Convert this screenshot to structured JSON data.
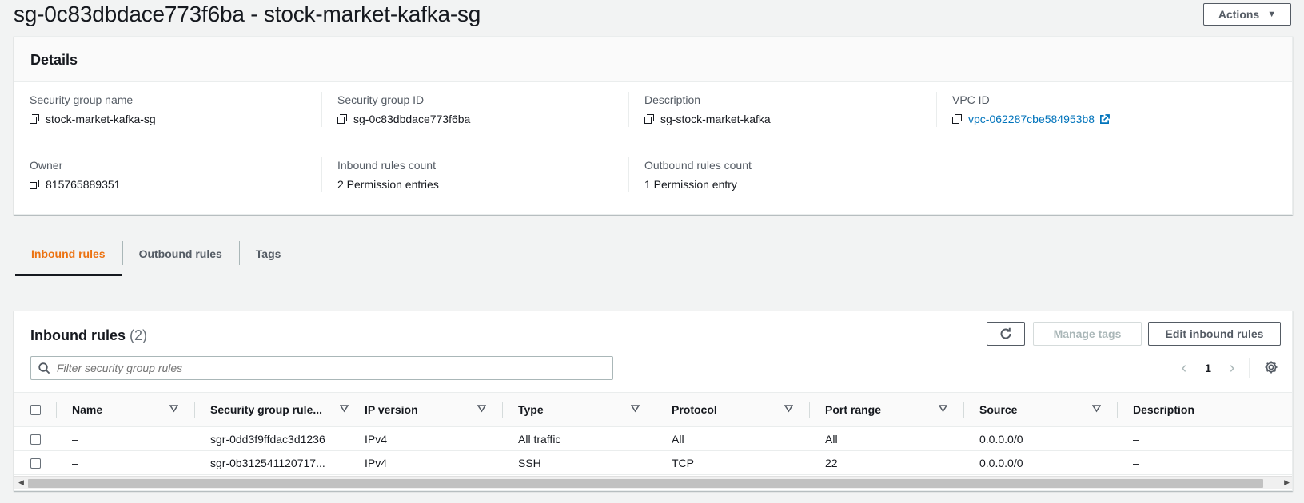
{
  "header": {
    "title": "sg-0c83dbdace773f6ba - stock-market-kafka-sg",
    "actions_label": "Actions"
  },
  "details": {
    "title": "Details",
    "fields": {
      "sg_name": {
        "label": "Security group name",
        "value": "stock-market-kafka-sg"
      },
      "sg_id": {
        "label": "Security group ID",
        "value": "sg-0c83dbdace773f6ba"
      },
      "description": {
        "label": "Description",
        "value": "sg-stock-market-kafka"
      },
      "vpc_id": {
        "label": "VPC ID",
        "value": "vpc-062287cbe584953b8"
      },
      "owner": {
        "label": "Owner",
        "value": "815765889351"
      },
      "inbound_count": {
        "label": "Inbound rules count",
        "value": "2 Permission entries"
      },
      "outbound_count": {
        "label": "Outbound rules count",
        "value": "1 Permission entry"
      }
    }
  },
  "tabs": [
    {
      "label": "Inbound rules",
      "active": true
    },
    {
      "label": "Outbound rules",
      "active": false
    },
    {
      "label": "Tags",
      "active": false
    }
  ],
  "rules": {
    "title": "Inbound rules",
    "count": "(2)",
    "manage_tags_label": "Manage tags",
    "edit_label": "Edit inbound rules",
    "filter_placeholder": "Filter security group rules",
    "page": "1",
    "columns": [
      "Name",
      "Security group rule...",
      "IP version",
      "Type",
      "Protocol",
      "Port range",
      "Source",
      "Description"
    ],
    "rows": [
      [
        "–",
        "sgr-0dd3f9ffdac3d1236",
        "IPv4",
        "All traffic",
        "All",
        "All",
        "0.0.0.0/0",
        "–"
      ],
      [
        "–",
        "sgr-0b312541120717...",
        "IPv4",
        "SSH",
        "TCP",
        "22",
        "0.0.0.0/0",
        "–"
      ]
    ]
  },
  "colors": {
    "accent_orange": "#ec7211",
    "link_blue": "#0073bb"
  }
}
